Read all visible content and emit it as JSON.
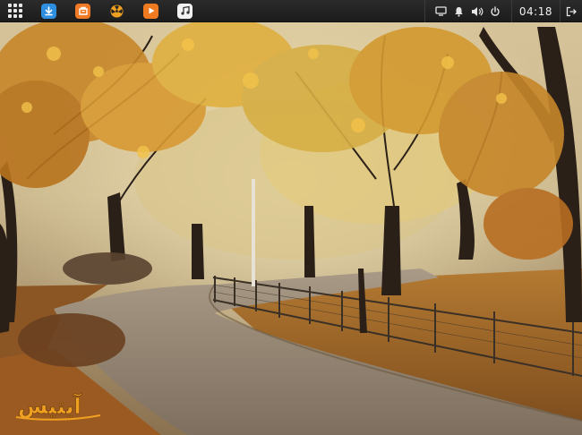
{
  "wallpaper": {
    "description_icon": "autumn-park-wallpaper"
  },
  "panel": {
    "launcher_icon": "app-grid-icon",
    "apps": [
      {
        "icon": "download-manager-icon",
        "color": "#2e8ee0"
      },
      {
        "icon": "file-manager-icon",
        "color": "#f07a26"
      },
      {
        "icon": "radioactive-app-icon",
        "color": "#222222"
      },
      {
        "icon": "media-player-icon",
        "color": "#f07a1f"
      },
      {
        "icon": "music-note-icon",
        "color": "#f2f2f2"
      }
    ],
    "tray": [
      "screen-icon",
      "notification-bell-icon",
      "volume-icon",
      "power-icon"
    ],
    "clock": "04:18",
    "logout_icon": "logout-icon"
  },
  "watermark": {
    "text": "آیتیس",
    "color": "#f0a020"
  }
}
